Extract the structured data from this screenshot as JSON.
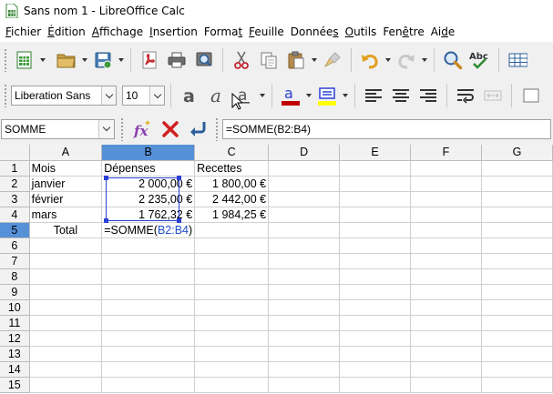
{
  "window": {
    "title": "Sans nom 1 - LibreOffice Calc"
  },
  "menu": [
    {
      "pre": "",
      "u": "F",
      "post": "ichier"
    },
    {
      "pre": "",
      "u": "É",
      "post": "dition"
    },
    {
      "pre": "",
      "u": "A",
      "post": "ffichage"
    },
    {
      "pre": "",
      "u": "I",
      "post": "nsertion"
    },
    {
      "pre": "Forma",
      "u": "t",
      "post": ""
    },
    {
      "pre": "",
      "u": "F",
      "post": "euille"
    },
    {
      "pre": "Donnée",
      "u": "s",
      "post": ""
    },
    {
      "pre": "",
      "u": "O",
      "post": "utils"
    },
    {
      "pre": "Fen",
      "u": "ê",
      "post": "tre"
    },
    {
      "pre": "Ai",
      "u": "d",
      "post": "e"
    }
  ],
  "format_toolbar": {
    "font_name": "Liberation Sans",
    "font_size": "10"
  },
  "formula_bar": {
    "name_box": "SOMME",
    "input": "=SOMME(B2:B4)"
  },
  "colors": {
    "selection_header": "#5691d8",
    "range_border": "#2b3fd6",
    "reference_text": "#1f4fc9",
    "font_color_bar": "#c00000",
    "highlight_bar": "#ffff00"
  },
  "sheet": {
    "columns": [
      "A",
      "B",
      "C",
      "D",
      "E",
      "F",
      "G"
    ],
    "rows": [
      "1",
      "2",
      "3",
      "4",
      "5",
      "6",
      "7",
      "8",
      "9",
      "10",
      "11",
      "12",
      "13",
      "14",
      "15"
    ],
    "cells": {
      "A1": "Mois",
      "B1": "Dépenses",
      "C1": "Recettes",
      "A2": "janvier",
      "B2": "2 000,00 €",
      "C2": "1 800,00 €",
      "A3": "février",
      "B3": "2 235,00 €",
      "C3": "2 442,00 €",
      "A4": "mars",
      "B4": "1 762,32 €",
      "C4": "1 984,25 €",
      "A5": "Total"
    },
    "edit_cell": {
      "prefix": "=SOMME(",
      "ref": "B2:B4",
      "suffix": ")"
    }
  }
}
